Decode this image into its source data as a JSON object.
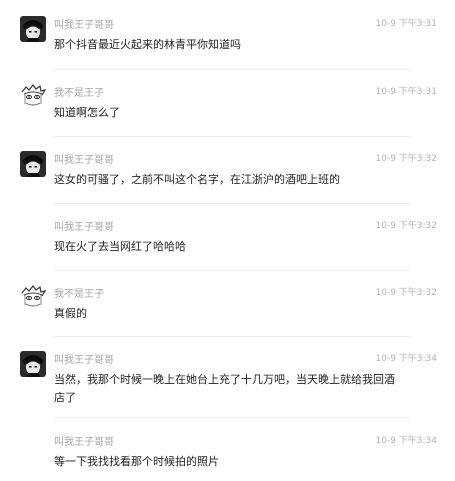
{
  "messages": [
    {
      "user": "叫我王子哥哥",
      "avatar": "dark-avatar-icon",
      "time": "10-9 下午3:31",
      "text": "那个抖音最近火起来的林青平你知道吗"
    },
    {
      "user": "我不是王子",
      "avatar": "sketch-avatar-icon",
      "time": "10-9 下午3:31",
      "text": "知道啊怎么了"
    },
    {
      "user": "叫我王子哥哥",
      "avatar": "dark-avatar-icon",
      "time": "10-9 下午3:32",
      "text": "这女的可骚了，之前不叫这个名字，在江浙沪的酒吧上班的"
    },
    {
      "user": "叫我王子哥哥",
      "avatar": "",
      "time": "10-9 下午3:32",
      "text": "现在火了去当网红了哈哈哈"
    },
    {
      "user": "我不是王子",
      "avatar": "sketch-avatar-icon",
      "time": "10-9 下午3:32",
      "text": "真假的"
    },
    {
      "user": "叫我王子哥哥",
      "avatar": "dark-avatar-icon",
      "time": "10-9 下午3:34",
      "text": "当然，我那个时候一晚上在她台上充了十几万吧，当天晚上就给我回酒店了"
    },
    {
      "user": "叫我王子哥哥",
      "avatar": "",
      "time": "10-9 下午3:34",
      "text": "等一下我找找看那个时候拍的照片"
    }
  ],
  "colors": {
    "name": "#a6a6a6",
    "time": "#b3b3b3",
    "text": "#222222",
    "divider": "#ececec"
  }
}
